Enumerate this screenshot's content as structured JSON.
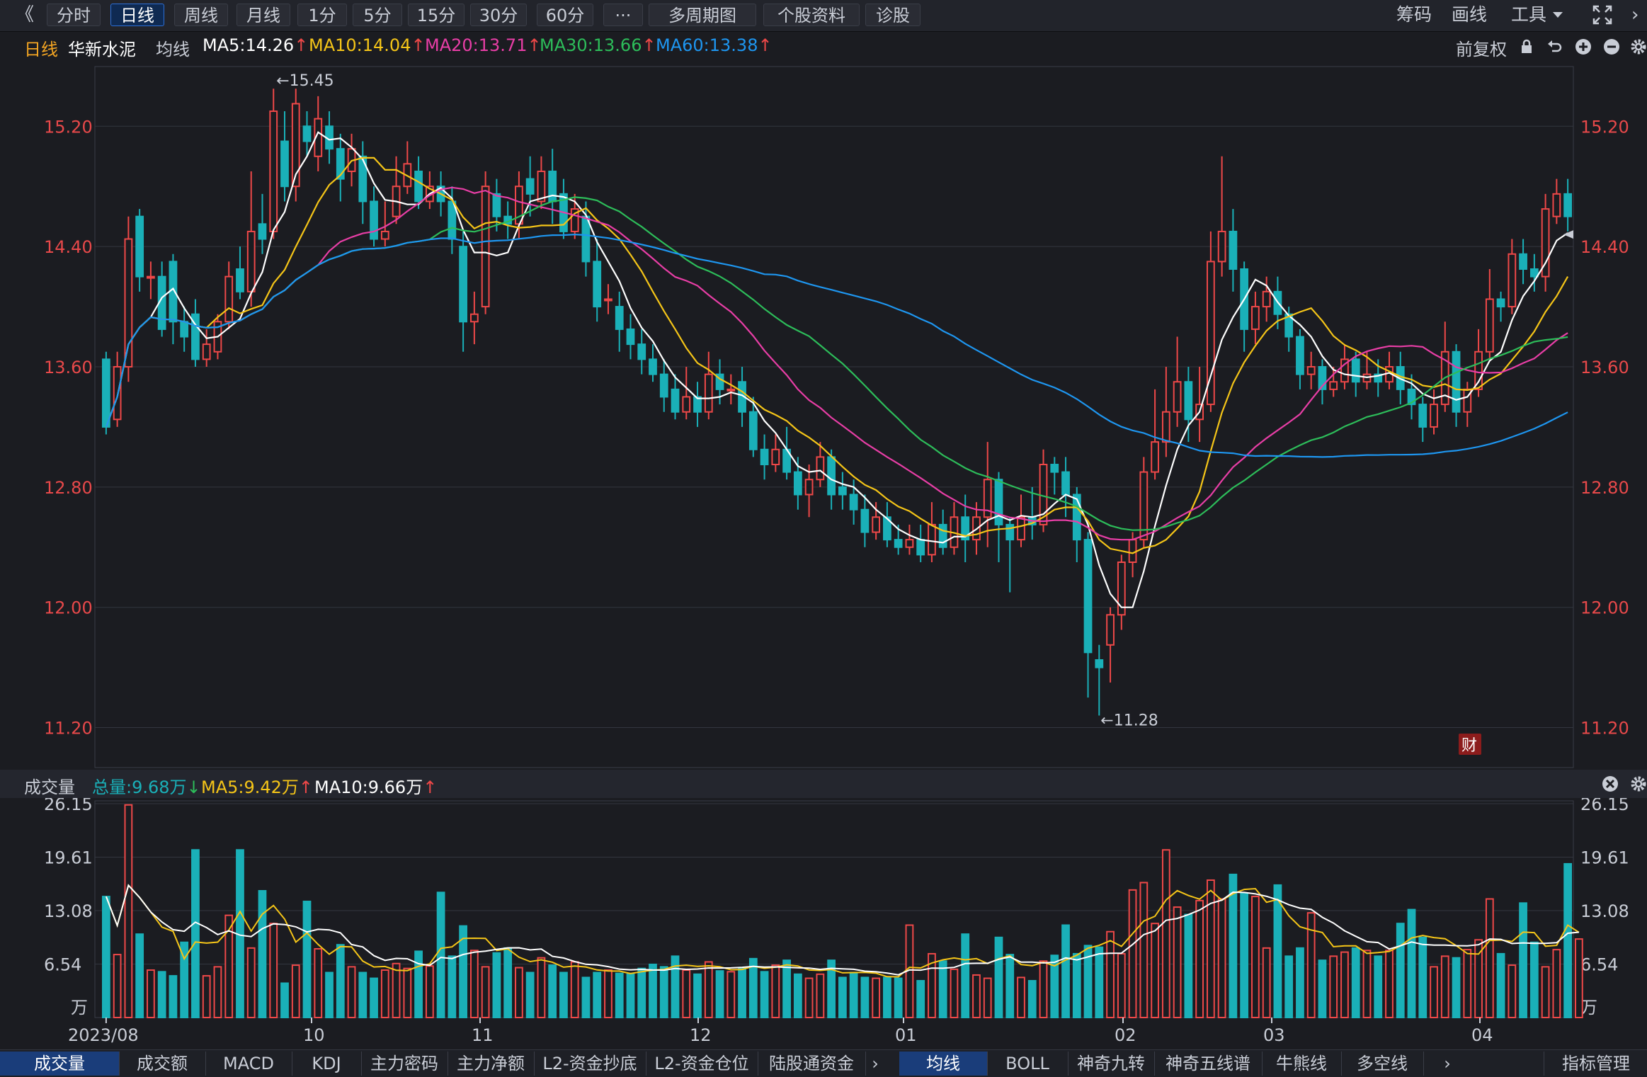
{
  "toolbar": {
    "back": "《",
    "buttons": [
      "分时",
      "日线",
      "周线",
      "月线",
      "1分",
      "5分",
      "15分",
      "30分",
      "60分",
      "···",
      "多周期图",
      "个股资料",
      "诊股"
    ],
    "active": "日线",
    "right": [
      "筹码",
      "画线",
      "工具"
    ]
  },
  "info": {
    "period": "日线",
    "stock_name": "华新水泥",
    "ma_label": "均线",
    "ma5": "MA5:14.26",
    "ma10": "MA10:14.04",
    "ma20": "MA20:13.71",
    "ma30": "MA30:13.66",
    "ma60": "MA60:13.38",
    "fuquan": "前复权"
  },
  "colors": {
    "up": "#ee4848",
    "down": "#1ab0b8",
    "ma5": "#ffffff",
    "ma10": "#f5c518",
    "ma20": "#e83ea6",
    "ma30": "#2dbd5a",
    "ma60": "#1e96f0",
    "axis_text": "#e8494a"
  },
  "volume_head": {
    "title": "成交量",
    "total": "总量:9.68万",
    "ma5": "MA5:9.42万",
    "ma10": "MA10:9.66万"
  },
  "badge_cai": "财",
  "bottom_tabs_left": [
    "成交量",
    "成交额",
    "MACD",
    "KDJ",
    "主力密码",
    "主力净额",
    "L2-资金抄底",
    "L2-资金仓位",
    "陆股通资金"
  ],
  "bottom_tabs_right": [
    "均线",
    "BOLL",
    "神奇九转",
    "神奇五线谱",
    "牛熊线",
    "多空线"
  ],
  "bottom_tab_manage": "指标管理",
  "chart_data": [
    {
      "type": "candlestick",
      "title": "华新水泥 日线",
      "yticks": [
        "15.20",
        "14.40",
        "13.60",
        "12.80",
        "12.00",
        "11.20"
      ],
      "ylim": [
        11.0,
        15.55
      ],
      "x_labels": [
        "10",
        "11",
        "12",
        "01",
        "02",
        "03",
        "04"
      ],
      "annotations": {
        "high": "←15.45",
        "low": "←11.28"
      },
      "current_price": "14.40",
      "candles": [
        [
          13.65,
          13.2,
          13.7,
          13.15
        ],
        [
          13.25,
          13.6,
          13.7,
          13.2
        ],
        [
          13.6,
          14.45,
          14.6,
          13.5
        ],
        [
          14.6,
          14.2,
          14.65,
          14.1
        ],
        [
          14.2,
          14.2,
          14.3,
          14.05
        ],
        [
          14.2,
          13.85,
          14.3,
          13.8
        ],
        [
          14.3,
          13.9,
          14.35,
          13.75
        ],
        [
          13.9,
          13.8,
          14.0,
          13.7
        ],
        [
          13.95,
          13.65,
          14.05,
          13.6
        ],
        [
          13.65,
          13.75,
          13.85,
          13.6
        ],
        [
          13.7,
          13.9,
          13.95,
          13.65
        ],
        [
          13.9,
          14.2,
          14.3,
          13.85
        ],
        [
          14.25,
          14.1,
          14.4,
          14.05
        ],
        [
          14.1,
          14.5,
          14.9,
          14.0
        ],
        [
          14.55,
          14.45,
          14.75,
          14.35
        ],
        [
          14.5,
          15.3,
          15.45,
          14.45
        ],
        [
          15.1,
          14.8,
          15.3,
          14.7
        ],
        [
          14.8,
          15.35,
          15.45,
          14.7
        ],
        [
          15.2,
          15.1,
          15.3,
          15.0
        ],
        [
          15.0,
          15.25,
          15.4,
          14.9
        ],
        [
          15.2,
          15.05,
          15.3,
          14.95
        ],
        [
          15.05,
          14.85,
          15.15,
          14.7
        ],
        [
          14.9,
          15.05,
          15.15,
          14.8
        ],
        [
          15.0,
          14.7,
          15.1,
          14.55
        ],
        [
          14.7,
          14.45,
          14.8,
          14.4
        ],
        [
          14.45,
          14.5,
          14.7,
          14.4
        ],
        [
          14.6,
          14.8,
          15.0,
          14.55
        ],
        [
          14.8,
          14.95,
          15.1,
          14.75
        ],
        [
          14.9,
          14.7,
          15.0,
          14.65
        ],
        [
          14.7,
          14.8,
          14.9,
          14.65
        ],
        [
          14.8,
          14.7,
          14.9,
          14.6
        ],
        [
          14.7,
          14.45,
          14.8,
          14.35
        ],
        [
          14.4,
          13.9,
          14.5,
          13.7
        ],
        [
          13.9,
          13.95,
          14.1,
          13.75
        ],
        [
          14.0,
          14.8,
          14.9,
          13.95
        ],
        [
          14.75,
          14.6,
          14.85,
          14.5
        ],
        [
          14.6,
          14.55,
          14.7,
          14.45
        ],
        [
          14.55,
          14.8,
          14.9,
          14.45
        ],
        [
          14.85,
          14.75,
          15.0,
          14.6
        ],
        [
          14.7,
          14.9,
          15.0,
          14.65
        ],
        [
          14.9,
          14.7,
          15.05,
          14.55
        ],
        [
          14.75,
          14.5,
          14.85,
          14.45
        ],
        [
          14.5,
          14.65,
          14.75,
          14.45
        ],
        [
          14.6,
          14.3,
          14.7,
          14.2
        ],
        [
          14.3,
          14.0,
          14.45,
          13.9
        ],
        [
          14.05,
          14.05,
          14.15,
          13.95
        ],
        [
          14.0,
          13.85,
          14.1,
          13.7
        ],
        [
          13.85,
          13.75,
          13.95,
          13.65
        ],
        [
          13.75,
          13.65,
          13.85,
          13.55
        ],
        [
          13.65,
          13.55,
          13.75,
          13.5
        ],
        [
          13.55,
          13.4,
          13.65,
          13.3
        ],
        [
          13.45,
          13.3,
          13.55,
          13.25
        ],
        [
          13.3,
          13.4,
          13.6,
          13.25
        ],
        [
          13.4,
          13.3,
          13.5,
          13.2
        ],
        [
          13.3,
          13.55,
          13.7,
          13.25
        ],
        [
          13.55,
          13.45,
          13.65,
          13.35
        ],
        [
          13.45,
          13.45,
          13.55,
          13.35
        ],
        [
          13.5,
          13.3,
          13.6,
          13.2
        ],
        [
          13.3,
          13.05,
          13.4,
          13.0
        ],
        [
          13.05,
          12.95,
          13.15,
          12.85
        ],
        [
          12.95,
          13.05,
          13.15,
          12.9
        ],
        [
          13.05,
          12.9,
          13.2,
          12.85
        ],
        [
          12.9,
          12.75,
          13.0,
          12.65
        ],
        [
          12.75,
          12.85,
          12.95,
          12.6
        ],
        [
          12.85,
          13.0,
          13.1,
          12.8
        ],
        [
          13.0,
          12.75,
          13.05,
          12.65
        ],
        [
          12.8,
          12.75,
          12.9,
          12.65
        ],
        [
          12.75,
          12.65,
          12.85,
          12.55
        ],
        [
          12.65,
          12.5,
          12.75,
          12.4
        ],
        [
          12.5,
          12.6,
          12.7,
          12.45
        ],
        [
          12.6,
          12.45,
          12.7,
          12.4
        ],
        [
          12.45,
          12.4,
          12.55,
          12.35
        ],
        [
          12.4,
          12.45,
          12.55,
          12.35
        ],
        [
          12.45,
          12.35,
          12.55,
          12.3
        ],
        [
          12.35,
          12.55,
          12.7,
          12.3
        ],
        [
          12.55,
          12.4,
          12.65,
          12.35
        ],
        [
          12.4,
          12.6,
          12.7,
          12.35
        ],
        [
          12.6,
          12.45,
          12.75,
          12.3
        ],
        [
          12.45,
          12.6,
          12.7,
          12.35
        ],
        [
          12.6,
          12.85,
          13.1,
          12.4
        ],
        [
          12.85,
          12.55,
          12.9,
          12.3
        ],
        [
          12.55,
          12.45,
          12.6,
          12.1
        ],
        [
          12.45,
          12.6,
          12.75,
          12.4
        ],
        [
          12.6,
          12.55,
          12.8,
          12.45
        ],
        [
          12.55,
          12.95,
          13.05,
          12.5
        ],
        [
          12.95,
          12.9,
          13.0,
          12.75
        ],
        [
          12.9,
          12.75,
          13.0,
          12.6
        ],
        [
          12.75,
          12.45,
          12.8,
          12.3
        ],
        [
          12.45,
          11.7,
          12.5,
          11.4
        ],
        [
          11.65,
          11.6,
          11.75,
          11.28
        ],
        [
          11.75,
          11.95,
          12.0,
          11.5
        ],
        [
          11.95,
          12.3,
          12.35,
          11.85
        ],
        [
          12.3,
          12.45,
          12.5,
          12.2
        ],
        [
          12.45,
          12.9,
          13.0,
          12.4
        ],
        [
          12.9,
          13.1,
          13.45,
          12.85
        ],
        [
          13.1,
          13.3,
          13.6,
          13.0
        ],
        [
          13.3,
          13.5,
          13.8,
          13.2
        ],
        [
          13.5,
          13.25,
          13.6,
          13.1
        ],
        [
          13.25,
          13.35,
          13.6,
          13.1
        ],
        [
          13.35,
          14.3,
          14.5,
          13.3
        ],
        [
          14.3,
          14.5,
          15.0,
          14.2
        ],
        [
          14.5,
          14.25,
          14.65,
          14.1
        ],
        [
          14.25,
          13.85,
          14.3,
          13.7
        ],
        [
          13.85,
          14.0,
          14.1,
          13.75
        ],
        [
          14.0,
          14.1,
          14.2,
          13.9
        ],
        [
          14.1,
          13.95,
          14.2,
          13.85
        ],
        [
          13.95,
          13.8,
          14.0,
          13.7
        ],
        [
          13.8,
          13.55,
          13.85,
          13.45
        ],
        [
          13.55,
          13.6,
          13.7,
          13.45
        ],
        [
          13.6,
          13.45,
          13.65,
          13.35
        ],
        [
          13.45,
          13.5,
          13.6,
          13.4
        ],
        [
          13.5,
          13.65,
          13.75,
          13.45
        ],
        [
          13.65,
          13.5,
          13.7,
          13.4
        ],
        [
          13.5,
          13.55,
          13.7,
          13.45
        ],
        [
          13.55,
          13.5,
          13.65,
          13.4
        ],
        [
          13.5,
          13.6,
          13.7,
          13.45
        ],
        [
          13.6,
          13.45,
          13.7,
          13.35
        ],
        [
          13.45,
          13.35,
          13.55,
          13.25
        ],
        [
          13.35,
          13.2,
          13.4,
          13.1
        ],
        [
          13.2,
          13.35,
          13.45,
          13.15
        ],
        [
          13.35,
          13.7,
          13.9,
          13.3
        ],
        [
          13.7,
          13.3,
          13.75,
          13.2
        ],
        [
          13.3,
          13.45,
          13.5,
          13.2
        ],
        [
          13.45,
          13.7,
          13.85,
          13.4
        ],
        [
          13.7,
          14.05,
          14.25,
          13.65
        ],
        [
          14.05,
          14.0,
          14.1,
          13.9
        ],
        [
          14.0,
          14.35,
          14.45,
          13.95
        ],
        [
          14.35,
          14.25,
          14.45,
          14.15
        ],
        [
          14.25,
          14.2,
          14.35,
          14.1
        ],
        [
          14.2,
          14.65,
          14.75,
          14.1
        ],
        [
          14.6,
          14.75,
          14.85,
          14.55
        ],
        [
          14.75,
          14.6,
          14.85,
          14.5
        ]
      ]
    },
    {
      "type": "bar",
      "title": "成交量",
      "yticks": [
        "26.15",
        "19.61",
        "13.08",
        "6.54"
      ],
      "yunit": "万",
      "ylim": [
        0,
        26.15
      ],
      "first_date": "2023/08",
      "volumes": [
        14.8,
        7.7,
        26.0,
        10.2,
        5.8,
        5.6,
        5.1,
        9.2,
        20.5,
        5.1,
        6.2,
        12.5,
        20.5,
        8.5,
        15.5,
        11.5,
        4.2,
        6.4,
        14.2,
        8.4,
        5.5,
        8.9,
        6.2,
        5.5,
        4.8,
        5.8,
        6.6,
        6.0,
        8.1,
        6.3,
        15.3,
        7.5,
        11.2,
        8.2,
        6.2,
        7.9,
        8.5,
        6.1,
        5.5,
        7.3,
        6.4,
        5.5,
        6.8,
        4.9,
        5.5,
        5.8,
        5.4,
        5.3,
        6.0,
        6.5,
        6.2,
        7.5,
        5.8,
        5.3,
        6.8,
        5.7,
        5.6,
        6.0,
        7.2,
        5.6,
        6.4,
        7.0,
        5.3,
        4.8,
        5.3,
        7.0,
        4.9,
        5.5,
        4.9,
        4.8,
        4.9,
        4.8,
        11.3,
        4.5,
        7.8,
        6.9,
        5.9,
        10.2,
        5.2,
        4.8,
        9.8,
        7.7,
        4.9,
        4.5,
        6.9,
        7.6,
        11.3,
        7.8,
        8.8,
        8.6,
        10.5,
        7.8,
        15.6,
        16.5,
        11.5,
        20.5,
        13.5,
        12.6,
        14.3,
        16.8,
        14.5,
        17.5,
        15.2,
        14.8,
        8.5,
        16.2,
        7.5,
        8.5,
        12.8,
        7.0,
        7.5,
        8.0,
        8.5,
        8.2,
        7.5,
        8.2,
        11.5,
        13.2,
        9.8,
        6.2,
        7.5,
        7.3,
        8.3,
        9.5,
        14.5,
        7.8,
        6.4,
        14.0,
        9.2,
        6.2,
        8.3,
        18.8,
        9.6
      ]
    }
  ]
}
